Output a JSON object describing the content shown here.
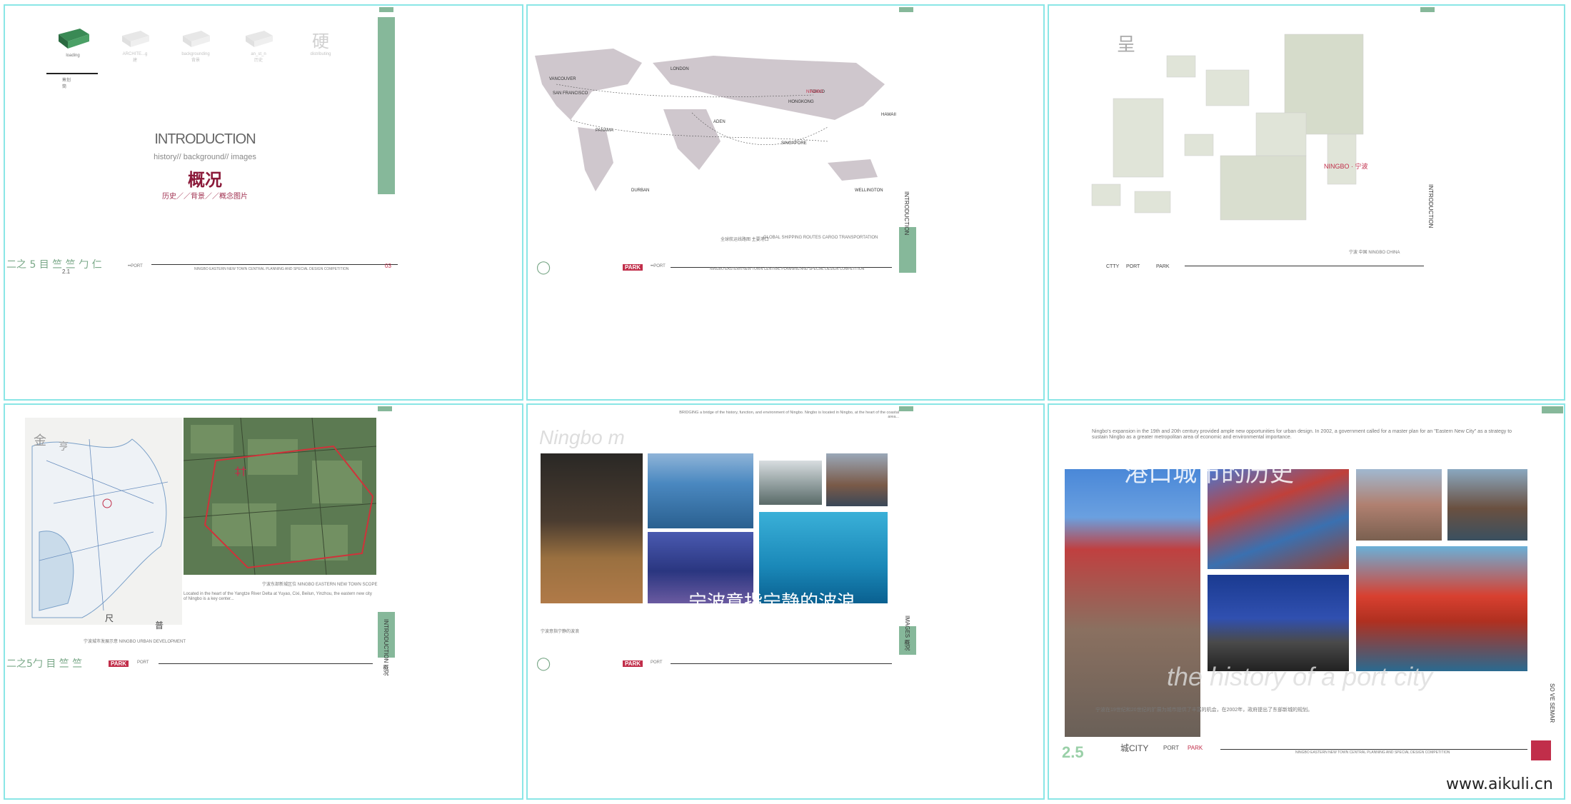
{
  "panel1": {
    "nav_items": [
      {
        "label": "loading",
        "sub": "筹划"
      },
      {
        "label": "ARCHITE...g",
        "sub": "建"
      },
      {
        "label": "backgrounding",
        "sub": "背景"
      },
      {
        "label": "an_st_n",
        "sub": "历史"
      },
      {
        "label": "distributing",
        "sub": "硬"
      }
    ],
    "nav_active_sub": "筹划",
    "nav_active_sub2": "筒",
    "title": "INTRODUCTION",
    "subtitle": "history// background// images",
    "title_cn": "概况",
    "subtitle_cn": "历史／／背景／／概念图片",
    "footer_left": "二之 5 目 竺 竺 勹 仁",
    "footer_num": "2.1",
    "footer_port": "••PORT",
    "footer_mid": "NINGBO EASTERN NEW TOWN CENTRAL PLANNING AND SPECIAL DESIGN COMPETITION",
    "footer_page": "03"
  },
  "panel2": {
    "cities": [
      "VANCOUVER",
      "SAN FRANCISCO",
      "LONDON",
      "TOKYO",
      "HONGKONG",
      "PANAMA",
      "ADEN",
      "SINGAPORE",
      "HAWAII",
      "DURBAN",
      "WELLINGTON",
      "NINGBO"
    ],
    "caption_cn": "全球航运线路图 主要港口",
    "caption_en": "GLOBAL SHIPPING ROUTES CARGO TRANSPORTATION",
    "footer_park": "PARK",
    "footer_port": "••PORT",
    "footer_mid": "NINGBO EASTERN NEW TOWN CENTRAL PLANNING AND SPECIAL DESIGN COMPETITION",
    "side_label": "INTRODUCTION"
  },
  "panel3": {
    "map_label": "NINGBO · 宁波",
    "caption": "宁波 中国 NINGBO CHINA",
    "big_char": "呈",
    "footer_city": "CTTY",
    "footer_port": "PORT",
    "footer_park": "PARK",
    "side_label": "INTRODUCTION"
  },
  "panel4": {
    "chars": [
      "金",
      "亨",
      "尺",
      "普"
    ],
    "map_caption": "宁波东部新城区位 NINGBO EASTERN NEW TOWN SCOPE",
    "desc": "Located in the heart of the Yangtze River Delta at Yuyao, Cixi, Beilun, Yinzhou, the eastern new city of Ningbo is a key center...",
    "left_caption": "宁波城市发展示意 NINGBO URBAN DEVELOPMENT",
    "footer_left": "二之5勹 目 竺 竺",
    "footer_park": "PARK",
    "footer_port": "PORT",
    "side_label": "INTRODUCTION 概况"
  },
  "panel5": {
    "header_text": "BRIDGING a bridge of the history, function, and environment of Ningbo. Ningbo is located in Ningbo, at the heart of the coastal area...",
    "script_title": "Ningbo m",
    "overlay_cn": "宁波意指宁静的波浪",
    "caption_cn": "宁波意指宁静的波浪",
    "footer_park": "PARK",
    "footer_port": "PORT",
    "side_label": "IMAGES 概况"
  },
  "panel6": {
    "header_text": "Ningbo's expansion in the 19th and 20th century provided ample new opportunities for urban design. In 2002, a government called for a master plan for an \"Eastern New City\" as a strategy to sustain Ningbo as a greater metropolitan area of economic and environmental importance.",
    "overlay_cn": "港口城市的历史",
    "overlay_en": "the history of a port city",
    "caption_cn": "宁波在19世纪和20世纪的扩展为城市提供了丰富的机会，在2002年，政府提出了东部新城的规划。",
    "footer_num": "2.5",
    "footer_city": "城CITY",
    "footer_port": "PORT",
    "footer_park": "PARK",
    "side_label": "SO VE SEMAR",
    "footer_mid": "NINGBO EASTERN NEW TOWN CENTRAL PLANNING AND SPECIAL DESIGN COMPETITION"
  },
  "watermark": "www.aikuli.cn",
  "colors": {
    "accent_green": "#86b89a",
    "accent_red": "#c12e4a",
    "title_red": "#8b1a3a",
    "border": "#8ae6e6"
  }
}
